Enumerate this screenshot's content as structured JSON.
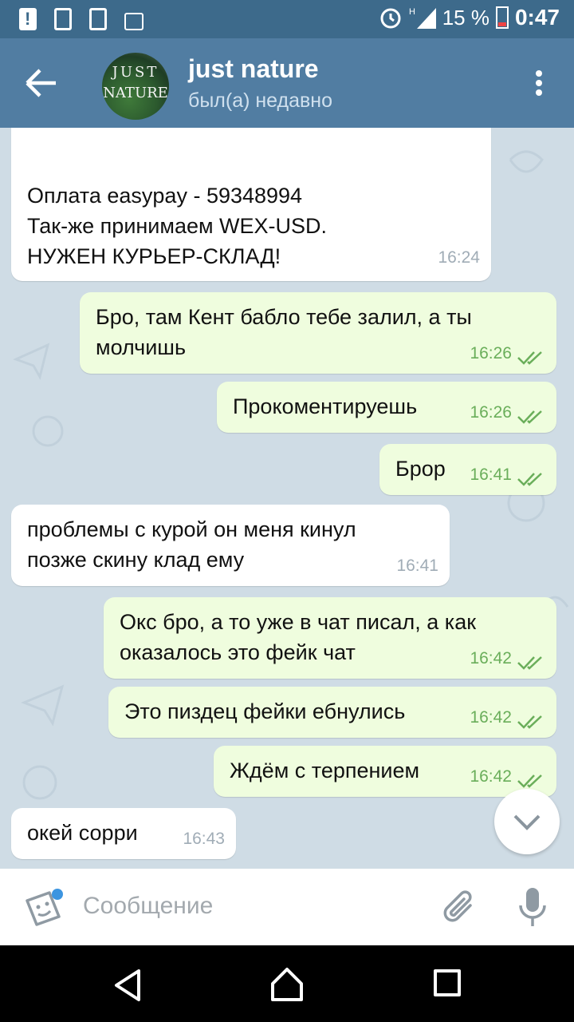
{
  "status_bar": {
    "time": "0:47",
    "battery": "15 %",
    "network": "H"
  },
  "header": {
    "title": "just nature",
    "subtitle": "был(а) недавно",
    "avatar_line1": "JUST",
    "avatar_line2": "NATURE"
  },
  "messages": [
    {
      "dir": "in",
      "text": "Оплата easypay - 59348994\nТак-же принимаем WEX-USD.\nНУЖЕН КУРЬЕР-СКЛАД!",
      "time": "16:24"
    },
    {
      "dir": "out",
      "text": "Бро, там Кент бабло тебе залил, а ты\nмолчишь",
      "time": "16:26"
    },
    {
      "dir": "out",
      "text": "Прокоментируешь",
      "time": "16:26"
    },
    {
      "dir": "out",
      "text": "Брор",
      "time": "16:41"
    },
    {
      "dir": "in",
      "text": "проблемы с курой он меня кинул\nпозже скину клад ему",
      "time": "16:41"
    },
    {
      "dir": "out",
      "text": "Окс бро, а то уже в чат писал, а как\nоказалось это фейк чат",
      "time": "16:42"
    },
    {
      "dir": "out",
      "text": "Это пиздец фейки ебнулись",
      "time": "16:42"
    },
    {
      "dir": "out",
      "text": "Ждём с терпением",
      "time": "16:42"
    },
    {
      "dir": "in",
      "text": "окей сорри",
      "time": "16:43"
    }
  ],
  "input": {
    "placeholder": "Сообщение"
  },
  "colors": {
    "header": "#517da2",
    "status_bar": "#3d6a8b",
    "outgoing_bubble": "#effdde",
    "incoming_bubble": "#ffffff",
    "check_color": "#6aae5a"
  },
  "icons": [
    "back-arrow-icon",
    "more-vert-icon",
    "sticker-icon",
    "paperclip-icon",
    "microphone-icon",
    "chevron-down-icon",
    "double-check-icon"
  ]
}
